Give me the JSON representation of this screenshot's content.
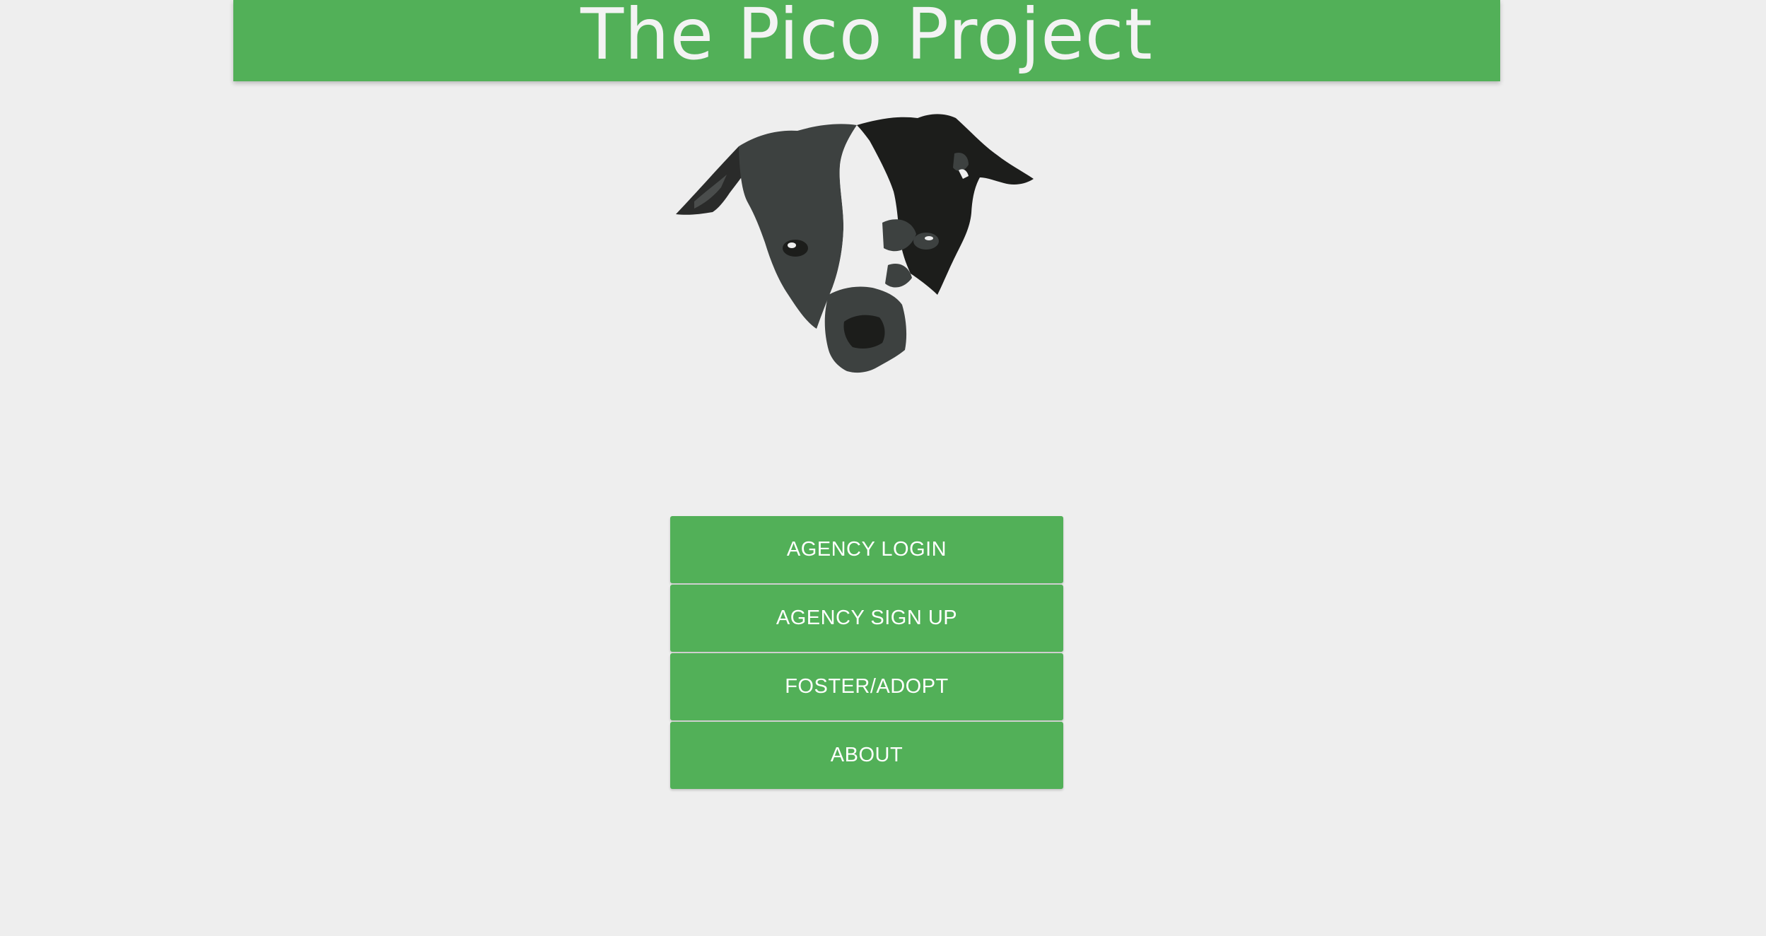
{
  "header": {
    "title": "The Pico Project",
    "background_color": "#52b058"
  },
  "logo": {
    "icon": "dog-head-icon"
  },
  "nav": {
    "agency_login_label": "AGENCY LOGIN",
    "agency_signup_label": "AGENCY SIGN UP",
    "foster_adopt_label": "FOSTER/ADOPT",
    "about_label": "ABOUT",
    "button_color": "#52b058"
  }
}
